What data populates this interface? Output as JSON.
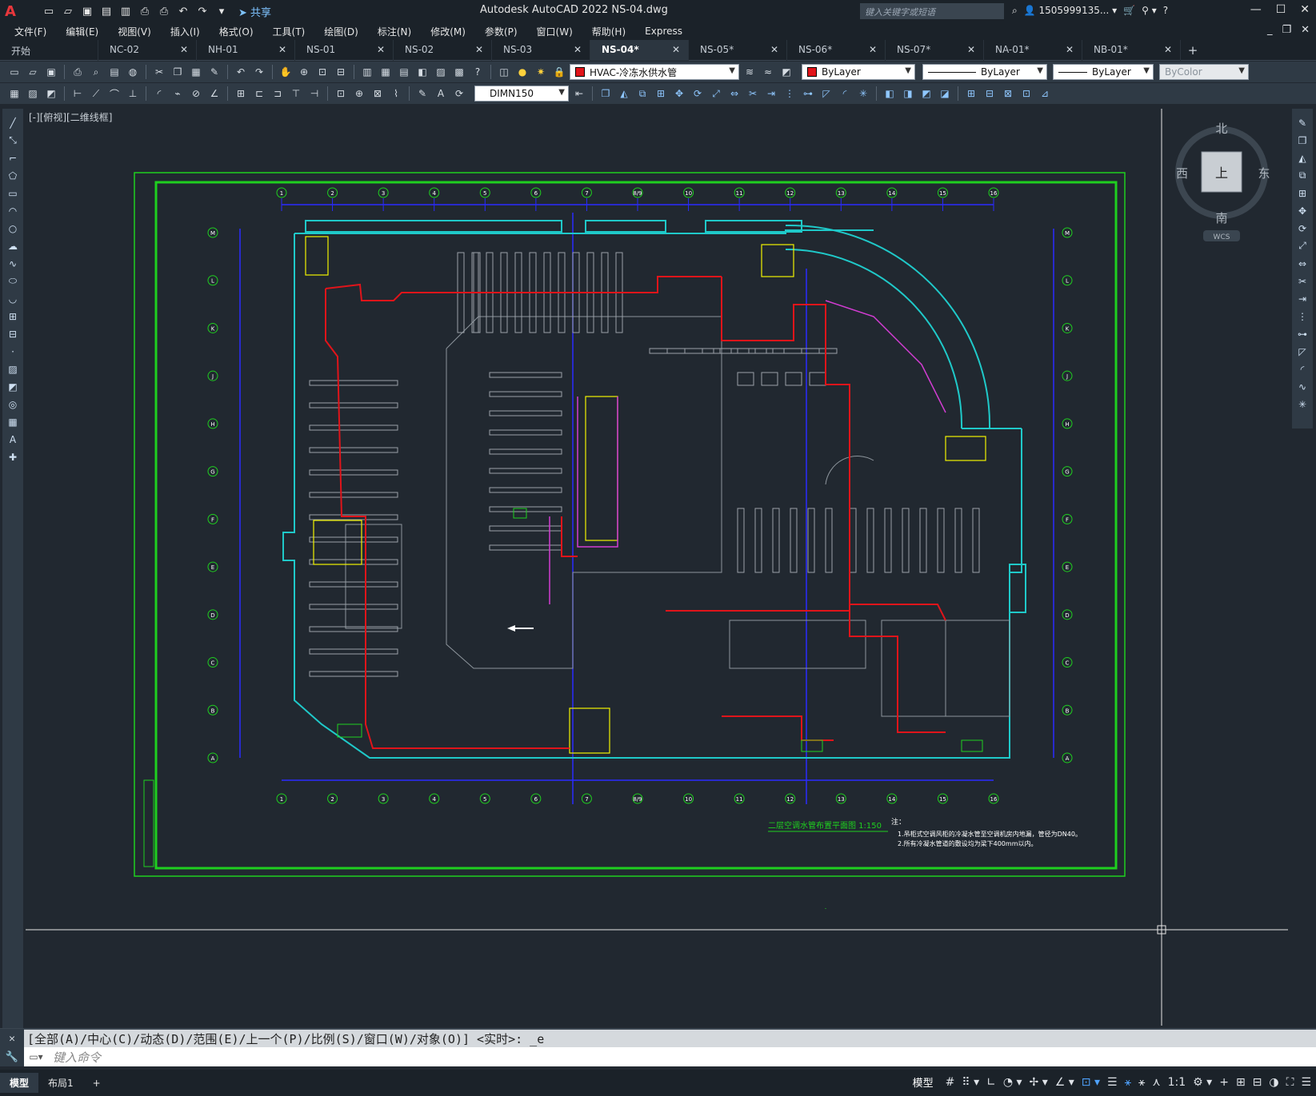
{
  "app": {
    "logo": "A",
    "title": "Autodesk AutoCAD 2022    NS-04.dwg",
    "share": "共享",
    "search_placeholder": "键入关键字或短语",
    "user": "1505999135...",
    "help": "?"
  },
  "menu": [
    "文件(F)",
    "编辑(E)",
    "视图(V)",
    "插入(I)",
    "格式(O)",
    "工具(T)",
    "绘图(D)",
    "标注(N)",
    "修改(M)",
    "参数(P)",
    "窗口(W)",
    "帮助(H)",
    "Express"
  ],
  "tabs": [
    {
      "label": "开始",
      "closable": false,
      "active": false
    },
    {
      "label": "NC-02",
      "closable": true,
      "active": false
    },
    {
      "label": "NH-01",
      "closable": true,
      "active": false
    },
    {
      "label": "NS-01",
      "closable": true,
      "active": false
    },
    {
      "label": "NS-02",
      "closable": true,
      "active": false
    },
    {
      "label": "NS-03",
      "closable": true,
      "active": false
    },
    {
      "label": "NS-04*",
      "closable": true,
      "active": true
    },
    {
      "label": "NS-05*",
      "closable": true,
      "active": false
    },
    {
      "label": "NS-06*",
      "closable": true,
      "active": false
    },
    {
      "label": "NS-07*",
      "closable": true,
      "active": false
    },
    {
      "label": "NA-01*",
      "closable": true,
      "active": false
    },
    {
      "label": "NB-01*",
      "closable": true,
      "active": false
    }
  ],
  "toolbar": {
    "layer": "HVAC-冷冻水供水管",
    "color": "ByLayer",
    "linetype": "ByLayer",
    "lineweight": "ByLayer",
    "plotstyle": "ByColor",
    "dimstyle": "DIMN150",
    "layer_color": "#e0141a"
  },
  "viewport": {
    "label": "[-][俯视][二维线框]",
    "compass": {
      "n": "北",
      "s": "南",
      "e": "东",
      "w": "西",
      "top": "上",
      "wcs": "WCS"
    }
  },
  "drawing": {
    "title": "二层空调水管布置平面图  1:150",
    "note_head": "注：",
    "note1": "1.吊柜式空调风柜的冷凝水管至空调机房内地漏，管径为DN40。",
    "note2": "2.所有冷凝水管道的敷设均为梁下400mm以内。",
    "grid_numbers": [
      "1",
      "2",
      "3",
      "4",
      "5",
      "6",
      "7",
      "8/9",
      "10",
      "11",
      "12",
      "13",
      "14",
      "15",
      "16"
    ],
    "grid_letters": [
      "M",
      "L",
      "K",
      "J",
      "H",
      "G",
      "F",
      "E",
      "D",
      "C",
      "B",
      "A"
    ],
    "colors": {
      "border": "#1fcf1f",
      "wall": "#1fc9c9",
      "pipe": "#e0141a",
      "axis": "#2a2aff",
      "equip": "#ffff00",
      "duct": "#d23cd2",
      "text": "#cfd6dd"
    }
  },
  "command": {
    "history": "[全部(A)/中心(C)/动态(D)/范围(E)/上一个(P)/比例(S)/窗口(W)/对象(O)] <实时>: _e",
    "placeholder": "键入命令"
  },
  "status": {
    "layout_tabs": [
      "模型",
      "布局1"
    ],
    "model": "模型",
    "scale": "1:1"
  }
}
